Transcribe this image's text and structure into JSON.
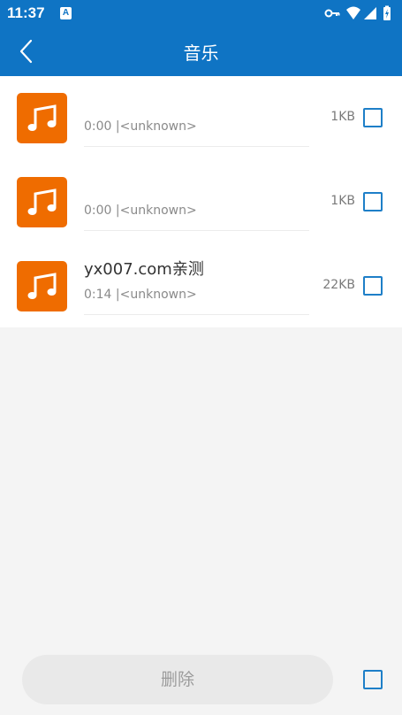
{
  "status_bar": {
    "time": "11:37",
    "notification_icon": "A",
    "icons": [
      "vpn-key-icon",
      "wifi-icon",
      "signal-icon",
      "battery-charging-icon"
    ]
  },
  "header": {
    "title": "音乐",
    "back_icon": "chevron-left-icon",
    "background_color": "#0f74c4"
  },
  "items": [
    {
      "name": "",
      "duration": "0:00",
      "artist": "<unknown>",
      "size": "1KB"
    },
    {
      "name": "",
      "duration": "0:00",
      "artist": "<unknown>",
      "size": "1KB"
    },
    {
      "name": "yx007.com亲测",
      "duration": "0:14",
      "artist": "<unknown>",
      "size": "22KB"
    }
  ],
  "footer": {
    "delete_label": "删除"
  },
  "colors": {
    "accent": "#1e7fc8",
    "music_icon_bg": "#ef6c00"
  }
}
